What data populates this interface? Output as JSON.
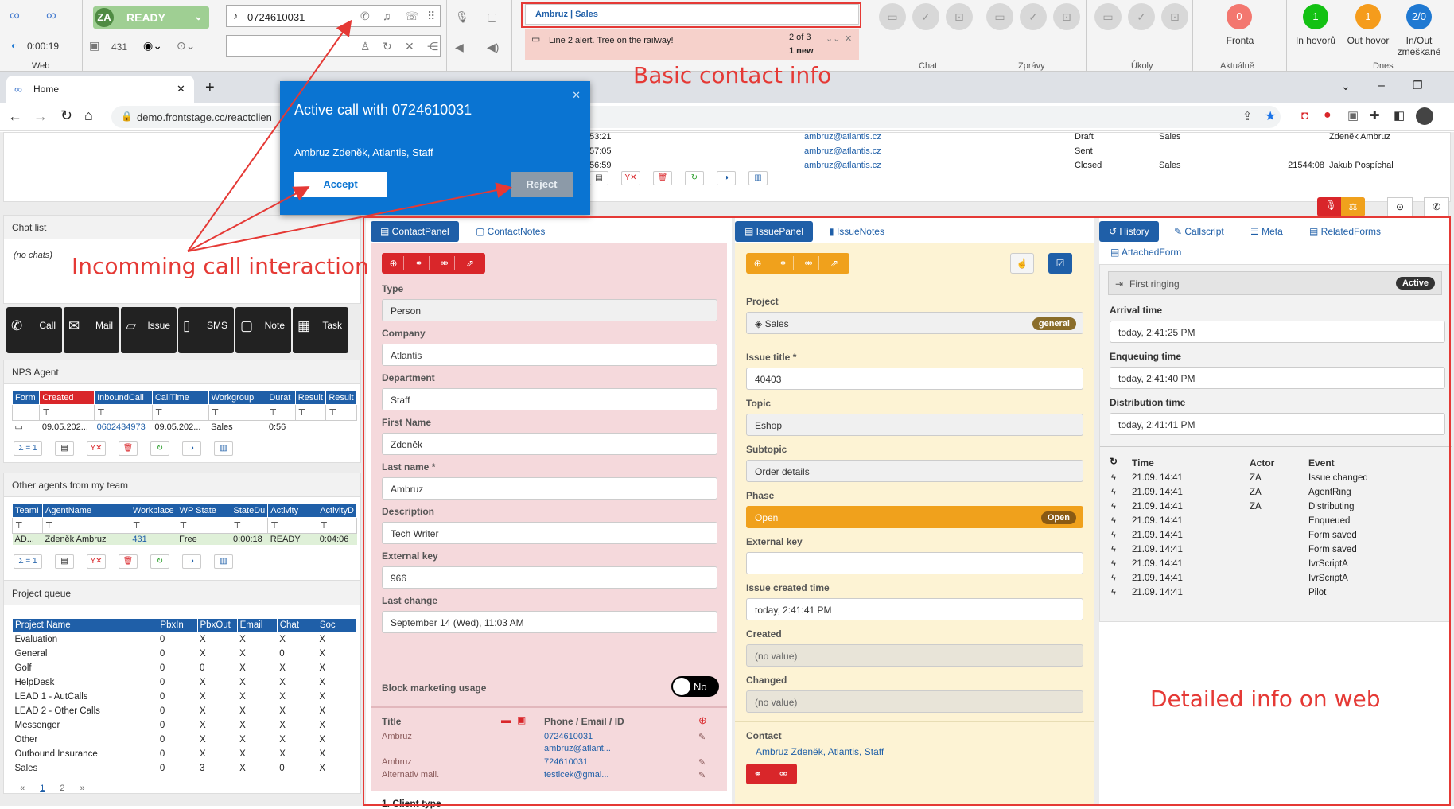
{
  "topbar": {
    "web_label": "Web",
    "timer": "0:00:19",
    "workplace": "431",
    "status": {
      "initials": "ZA",
      "label": "READY"
    },
    "phone_value": "0724610031",
    "contact_header": "Ambruz | Sales",
    "alert": {
      "text": "Line 2 alert. Tree on the railway!",
      "count": "2 of 3",
      "new": "1 new"
    },
    "groups": {
      "chat": "Chat",
      "zpravy": "Zprávy",
      "ukoly": "Úkoly",
      "aktualne": "Aktuálně",
      "dnes": "Dnes"
    },
    "counters": [
      {
        "value": "0",
        "label": "Fronta",
        "color": "#f3776f"
      },
      {
        "value": "1",
        "label": "In hovorů",
        "color": "#13c113"
      },
      {
        "value": "1",
        "label": "Out hovor",
        "color": "#f59c1c"
      },
      {
        "value": "2/0",
        "label": "In/Out zmeškané",
        "color": "#1f79d2"
      }
    ]
  },
  "browser": {
    "tab_title": "Home",
    "url": "demo.frontstage.cc/reactclien"
  },
  "popup": {
    "title": "Active call with 0724610031",
    "info": "Ambruz Zdeněk, Atlantis, Staff",
    "accept": "Accept",
    "reject": "Reject"
  },
  "top_table": {
    "rows": [
      {
        "time": "53:21",
        "email": "ambruz@atlantis.cz",
        "status": "Draft",
        "proj": "Sales",
        "dur": "",
        "agent": "Zdeněk Ambruz"
      },
      {
        "time": "57:05",
        "email": "ambruz@atlantis.cz",
        "status": "Sent",
        "proj": "",
        "dur": "",
        "agent": ""
      },
      {
        "time": "56:59",
        "email": "ambruz@atlantis.cz",
        "status": "Closed",
        "proj": "Sales",
        "dur": "21544:08",
        "agent": "Jakub Pospíchal"
      }
    ]
  },
  "chat_list": {
    "title": "Chat list",
    "empty": "(no chats)"
  },
  "actions": [
    "Call",
    "Mail",
    "Issue",
    "SMS",
    "Note",
    "Task"
  ],
  "nps": {
    "title": "NPS Agent",
    "headers": [
      "Form",
      "Created",
      "InboundCall",
      "CallTime",
      "Workgroup",
      "Durat",
      "Result",
      "Result"
    ],
    "row": [
      "09.05.202...",
      "0602434973",
      "09.05.202...",
      "Sales",
      "0:56"
    ],
    "sum": "Σ = 1"
  },
  "team": {
    "title": "Other agents from my team",
    "headers": [
      "TeamI",
      "AgentName",
      "Workplace",
      "WP State",
      "StateDu",
      "Activity",
      "ActivityD"
    ],
    "row": [
      "AD...",
      "Zdeněk Ambruz",
      "431",
      "Free",
      "0:00:18",
      "READY",
      "0:04:06"
    ],
    "sum": "Σ = 1"
  },
  "queue": {
    "title": "Project queue",
    "headers": [
      "Project Name",
      "PbxIn",
      "PbxOut",
      "Email",
      "Chat",
      "Soc"
    ],
    "rows": [
      [
        "Evaluation",
        "0",
        "X",
        "X",
        "X",
        "X"
      ],
      [
        "General",
        "0",
        "X",
        "X",
        "0",
        "X"
      ],
      [
        "Golf",
        "0",
        "0",
        "X",
        "X",
        "X"
      ],
      [
        "HelpDesk",
        "0",
        "X",
        "X",
        "X",
        "X"
      ],
      [
        "LEAD 1 - AutCalls",
        "0",
        "X",
        "X",
        "X",
        "X"
      ],
      [
        "LEAD 2 - Other Calls",
        "0",
        "X",
        "X",
        "X",
        "X"
      ],
      [
        "Messenger",
        "0",
        "X",
        "X",
        "X",
        "X"
      ],
      [
        "Other",
        "0",
        "X",
        "X",
        "X",
        "X"
      ],
      [
        "Outbound Insurance",
        "0",
        "X",
        "X",
        "X",
        "X"
      ],
      [
        "Sales",
        "0",
        "3",
        "X",
        "0",
        "X"
      ]
    ],
    "pager": {
      "prev": "«",
      "p1": "1",
      "p2": "2",
      "next": "»"
    }
  },
  "contact": {
    "tab": "ContactPanel",
    "tab2": "ContactNotes",
    "fields": [
      {
        "label": "Type",
        "value": "Person",
        "gray": true
      },
      {
        "label": "Company",
        "value": "Atlantis"
      },
      {
        "label": "Department",
        "value": "Staff"
      },
      {
        "label": "First Name",
        "value": "Zdeněk"
      },
      {
        "label": "Last name *",
        "value": "Ambruz"
      },
      {
        "label": "Description",
        "value": "Tech Writer"
      },
      {
        "label": "External key",
        "value": "966"
      },
      {
        "label": "Last change",
        "value": "September 14 (Wed), 11:03 AM"
      }
    ],
    "block_label": "Block marketing usage",
    "block_value": "No",
    "list_title": "Title",
    "list_phone": "Phone / Email / ID",
    "list": [
      {
        "title": "Ambruz",
        "v1": "0724610031",
        "v2": "ambruz@atlant..."
      },
      {
        "title": "Ambruz",
        "v1": "724610031",
        "v2": ""
      },
      {
        "title": "Alternativ mail.",
        "v1": "testicek@gmai...",
        "v2": ""
      }
    ],
    "client_type": "1. Client type"
  },
  "issue": {
    "tab": "IssuePanel",
    "tab2": "IssueNotes",
    "project_label": "Project",
    "project": "Sales",
    "project_badge": "general",
    "title_label": "Issue title *",
    "title": "40403",
    "topic_label": "Topic",
    "topic": "Eshop",
    "subtopic_label": "Subtopic",
    "subtopic": "Order details",
    "phase_label": "Phase",
    "phase": "Open",
    "phase_badge": "Open",
    "extkey_label": "External key",
    "extkey": "",
    "created_time_label": "Issue created time",
    "created_time": "today, 2:41:41 PM",
    "created_label": "Created",
    "created": "(no value)",
    "changed_label": "Changed",
    "changed": "(no value)",
    "contact_label": "Contact",
    "contact": "Ambruz Zdeněk, Atlantis, Staff"
  },
  "history": {
    "tabs": [
      "History",
      "Callscript",
      "Meta",
      "RelatedForms",
      "AttachedForm"
    ],
    "state": "First ringing",
    "state_badge": "Active",
    "arrival_label": "Arrival time",
    "arrival": "today, 2:41:25 PM",
    "enqueue_label": "Enqueuing time",
    "enqueue": "today, 2:41:40 PM",
    "distrib_label": "Distribution time",
    "distrib": "today, 2:41:41 PM",
    "headers": [
      "Time",
      "Actor",
      "Event"
    ],
    "events": [
      [
        "21.09. 14:41",
        "ZA",
        "Issue changed"
      ],
      [
        "21.09. 14:41",
        "ZA",
        "AgentRing"
      ],
      [
        "21.09. 14:41",
        "ZA",
        "Distributing"
      ],
      [
        "21.09. 14:41",
        "",
        "Enqueued"
      ],
      [
        "21.09. 14:41",
        "",
        "Form saved"
      ],
      [
        "21.09. 14:41",
        "",
        "Form saved"
      ],
      [
        "21.09. 14:41",
        "",
        "IvrScriptA"
      ],
      [
        "21.09. 14:41",
        "",
        "IvrScriptA"
      ],
      [
        "21.09. 14:41",
        "",
        "Pilot"
      ]
    ]
  },
  "annotations": {
    "basic": "Basic contact info",
    "incoming": "Incomming call interaction",
    "detailed": "Detailed info on web"
  },
  "colors": {
    "accent": "#1f5fa8",
    "annot": "#e53935",
    "contact_bg": "#f5d9dc",
    "issue_bg": "#fdf3d4"
  }
}
